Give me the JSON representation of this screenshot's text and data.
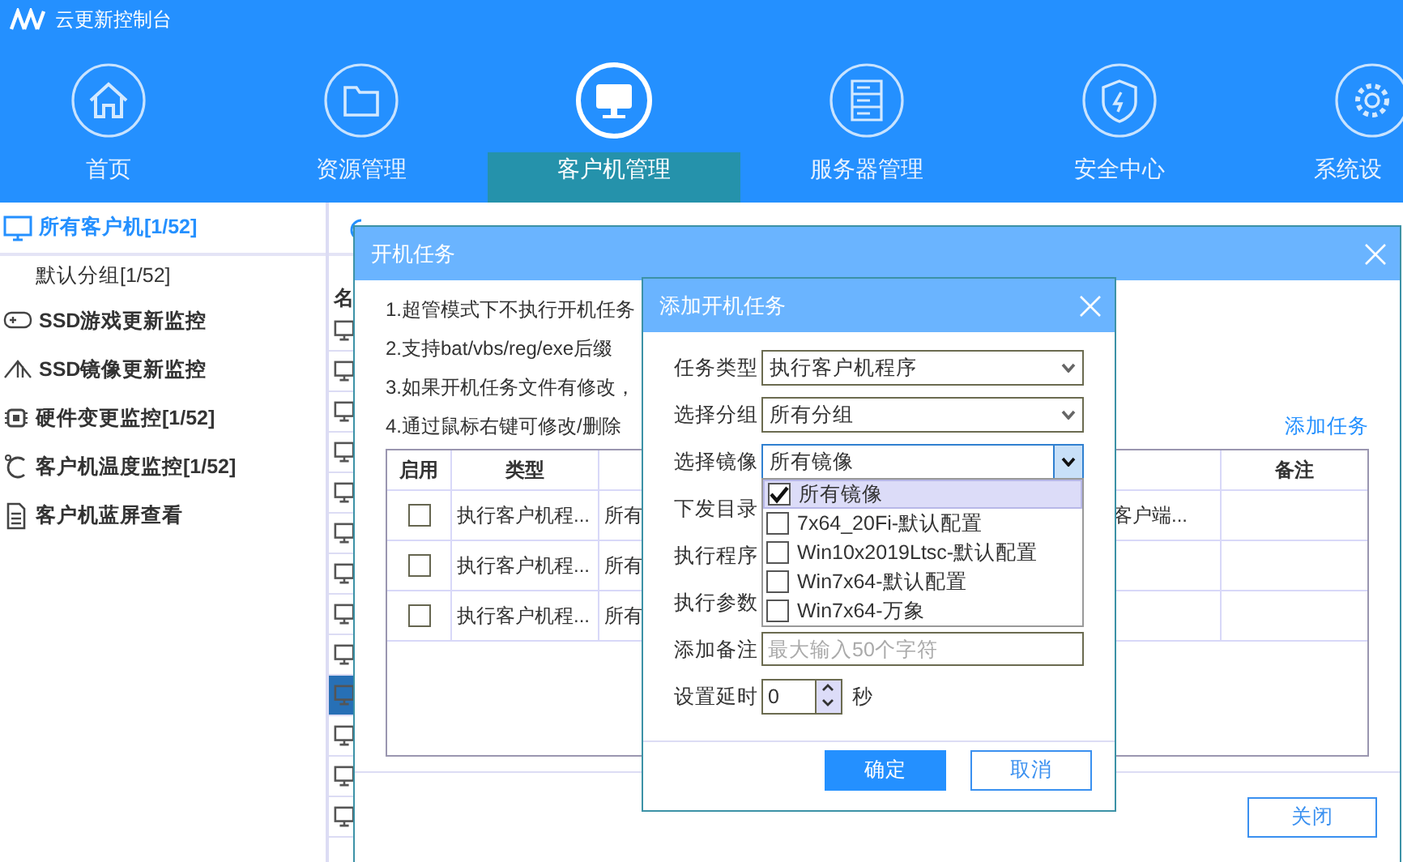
{
  "app": {
    "title": "云更新控制台"
  },
  "nav": [
    {
      "label": "首页",
      "kind": "home",
      "selected": false
    },
    {
      "label": "资源管理",
      "kind": "folder",
      "selected": false
    },
    {
      "label": "客户机管理",
      "kind": "monitor",
      "selected": true
    },
    {
      "label": "服务器管理",
      "kind": "server",
      "selected": false
    },
    {
      "label": "安全中心",
      "kind": "shield",
      "selected": false
    },
    {
      "label": "系统设",
      "kind": "gear",
      "selected": false
    }
  ],
  "sidebar": {
    "items": [
      {
        "label": "所有客户机[1/52]",
        "kind": "monitor",
        "selected": true,
        "children": [
          {
            "label": "默认分组[1/52]",
            "selected": false
          }
        ]
      },
      {
        "label": "SSD游戏更新监控",
        "kind": "gamepad",
        "selected": false
      },
      {
        "label": "SSD镜像更新监控",
        "kind": "layers",
        "selected": false
      },
      {
        "label": "硬件变更监控[1/52]",
        "kind": "chip",
        "selected": false
      },
      {
        "label": "客户机温度监控[1/52]",
        "kind": "thermometer",
        "selected": false
      },
      {
        "label": "客户机蓝屏查看",
        "kind": "document",
        "selected": false
      }
    ]
  },
  "client_list": {
    "header": "名",
    "rows": [
      {
        "selected": false
      },
      {
        "selected": false
      },
      {
        "selected": false
      },
      {
        "selected": false
      },
      {
        "selected": false
      },
      {
        "selected": false
      },
      {
        "selected": false
      },
      {
        "selected": false
      },
      {
        "selected": false
      },
      {
        "selected": true
      },
      {
        "selected": false
      },
      {
        "selected": false
      },
      {
        "selected": false
      }
    ]
  },
  "task_dialog": {
    "title": "开机任务",
    "notes": [
      "1.超管模式下不执行开机任务",
      "2.支持bat/vbs/reg/exe后缀",
      "3.如果开机任务文件有修改，",
      "4.通过鼠标右键可修改/删除"
    ],
    "add_link": "添加任务",
    "columns": {
      "enabled": "启用",
      "type": "类型",
      "note": "备注"
    },
    "rows": [
      {
        "enabled": false,
        "type": "执行客户机程...",
        "column_3": "所有",
        "column_4": "客户端..."
      },
      {
        "enabled": false,
        "type": "执行客户机程...",
        "column_3": "所有"
      },
      {
        "enabled": false,
        "type": "执行客户机程...",
        "column_3": "所有"
      }
    ],
    "close_button": "关闭"
  },
  "add_dialog": {
    "title": "添加开机任务",
    "fields": [
      {
        "label": "任务类型",
        "kind": "select",
        "value": "执行客户机程序",
        "expanded": false
      },
      {
        "label": "选择分组",
        "kind": "select",
        "value": "所有分组",
        "expanded": false
      },
      {
        "label": "选择镜像",
        "kind": "select",
        "value": "所有镜像",
        "expanded": true,
        "options": [
          {
            "label": "所有镜像",
            "checked": true,
            "selected": true
          },
          {
            "label": "7x64_20Fi-默认配置",
            "checked": false,
            "selected": false
          },
          {
            "label": "Win10x2019Ltsc-默认配置",
            "checked": false,
            "selected": false
          },
          {
            "label": "Win7x64-默认配置",
            "checked": false,
            "selected": false
          },
          {
            "label": "Win7x64-万象",
            "checked": false,
            "selected": false
          }
        ]
      },
      {
        "label": "下发目录",
        "kind": "covered"
      },
      {
        "label": "执行程序",
        "kind": "covered"
      },
      {
        "label": "执行参数",
        "kind": "covered"
      },
      {
        "label": "添加备注",
        "kind": "text",
        "placeholder": "最大输入50个字符"
      },
      {
        "label": "设置延时",
        "kind": "spinner",
        "value": "0",
        "unit": "秒"
      }
    ],
    "buttons": [
      {
        "label": "确定",
        "primary": true
      },
      {
        "label": "取消",
        "primary": false
      }
    ]
  }
}
